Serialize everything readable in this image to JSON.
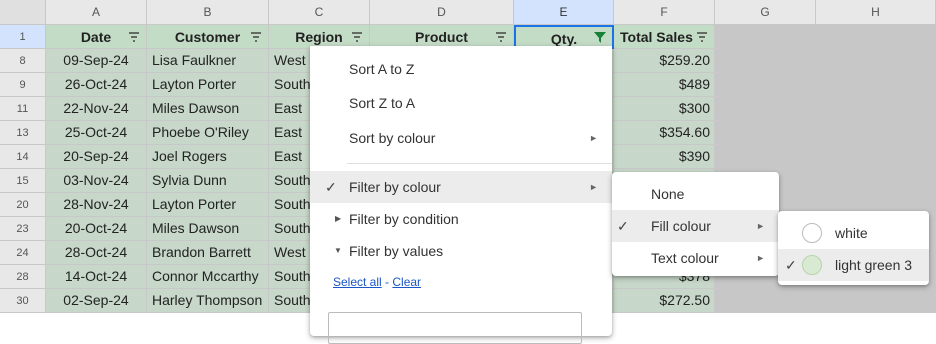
{
  "columns": [
    "A",
    "B",
    "C",
    "D",
    "E",
    "F",
    "G",
    "H"
  ],
  "header_row_number": "1",
  "headers": [
    "Date",
    "Customer",
    "Region",
    "Product",
    "Qty.",
    "Total Sales"
  ],
  "rows": [
    {
      "n": "8",
      "date": "09-Sep-24",
      "customer": "Lisa Faulkner",
      "region": "West",
      "total": "$259.20"
    },
    {
      "n": "9",
      "date": "26-Oct-24",
      "customer": "Layton Porter",
      "region": "South",
      "total": "$489"
    },
    {
      "n": "11",
      "date": "22-Nov-24",
      "customer": "Miles Dawson",
      "region": "East",
      "total": "$300"
    },
    {
      "n": "13",
      "date": "25-Oct-24",
      "customer": "Phoebe O'Riley",
      "region": "East",
      "total": "$354.60"
    },
    {
      "n": "14",
      "date": "20-Sep-24",
      "customer": "Joel Rogers",
      "region": "East",
      "total": "$390"
    },
    {
      "n": "15",
      "date": "03-Nov-24",
      "customer": "Sylvia Dunn",
      "region": "South",
      "total": ""
    },
    {
      "n": "20",
      "date": "28-Nov-24",
      "customer": "Layton Porter",
      "region": "South",
      "total": ""
    },
    {
      "n": "23",
      "date": "20-Oct-24",
      "customer": "Miles Dawson",
      "region": "South",
      "total": ""
    },
    {
      "n": "24",
      "date": "28-Oct-24",
      "customer": "Brandon Barrett",
      "region": "West",
      "total": ""
    },
    {
      "n": "28",
      "date": "14-Oct-24",
      "customer": "Connor Mccarthy",
      "region": "South",
      "total": "$378"
    },
    {
      "n": "30",
      "date": "02-Sep-24",
      "customer": "Harley Thompson",
      "region": "South",
      "total": "$272.50"
    }
  ],
  "filter_menu": {
    "sort_az": "Sort A to Z",
    "sort_za": "Sort Z to A",
    "sort_colour": "Sort by colour",
    "filter_colour": "Filter by colour",
    "filter_condition": "Filter by condition",
    "filter_values": "Filter by values",
    "select_all": "Select all",
    "separator": " - ",
    "clear": "Clear"
  },
  "colour_submenu": {
    "none": "None",
    "fill": "Fill colour",
    "text": "Text colour"
  },
  "fill_submenu": {
    "white": "white",
    "light_green": "light green 3",
    "white_color": "#ffffff",
    "light_green_color": "#d9ead3"
  },
  "colors": {
    "header_fill": "#c3dcc6",
    "row_fill": "#c7d7c9",
    "selection": "#d3e3fd",
    "filter_active": "#188038"
  }
}
